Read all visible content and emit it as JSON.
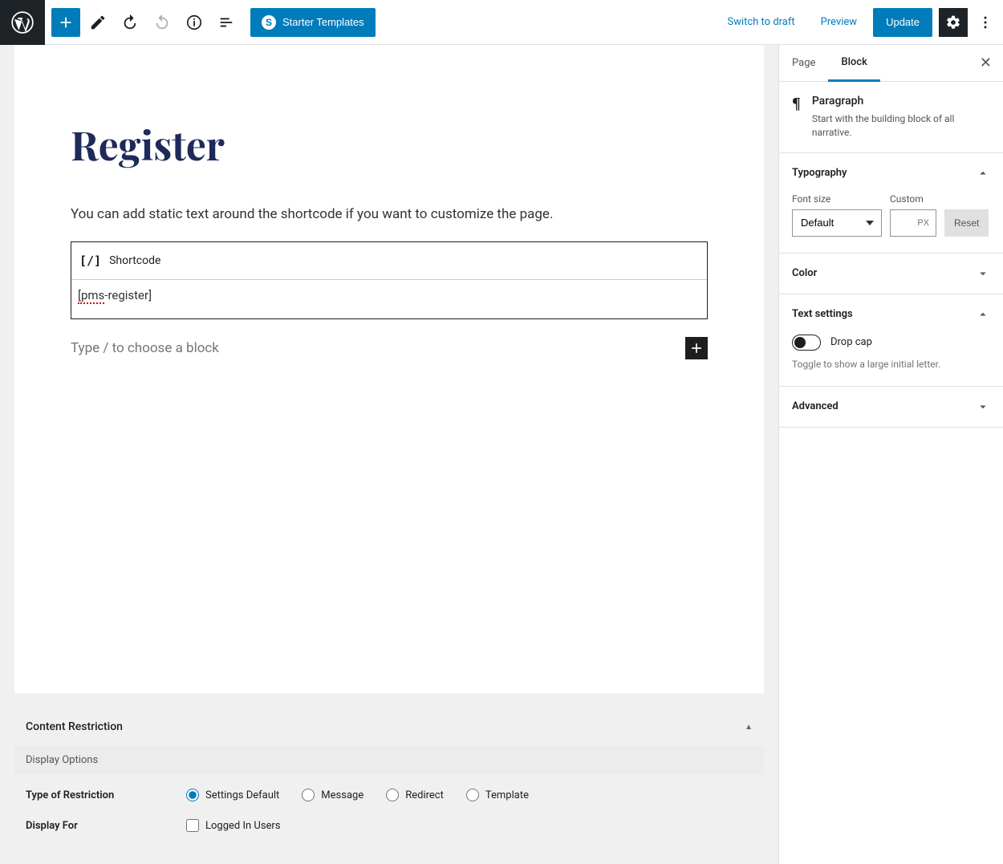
{
  "toolbar": {
    "starter_templates": "Starter Templates",
    "switch_draft": "Switch to draft",
    "preview": "Preview",
    "update": "Update"
  },
  "editor": {
    "title": "Register",
    "paragraph": "You can add static text around the shortcode if you want to customize the page.",
    "shortcode_label": "Shortcode",
    "shortcode_prefix": "[pms",
    "shortcode_suffix": "-register]",
    "add_placeholder": "Type / to choose a block"
  },
  "meta": {
    "panel_title": "Content Restriction",
    "sub_title": "Display Options",
    "restriction_label": "Type of Restriction",
    "restriction_opts": [
      "Settings Default",
      "Message",
      "Redirect",
      "Template"
    ],
    "display_for_label": "Display For",
    "display_for_opt": "Logged In Users"
  },
  "sidebar": {
    "tabs": {
      "page": "Page",
      "block": "Block"
    },
    "block": {
      "name": "Paragraph",
      "desc": "Start with the building block of all narrative."
    },
    "typography": {
      "title": "Typography",
      "font_size_label": "Font size",
      "custom_label": "Custom",
      "select_value": "Default",
      "unit": "PX",
      "reset": "Reset"
    },
    "color": {
      "title": "Color"
    },
    "text_settings": {
      "title": "Text settings",
      "drop_cap": "Drop cap",
      "desc": "Toggle to show a large initial letter."
    },
    "advanced": {
      "title": "Advanced"
    }
  }
}
